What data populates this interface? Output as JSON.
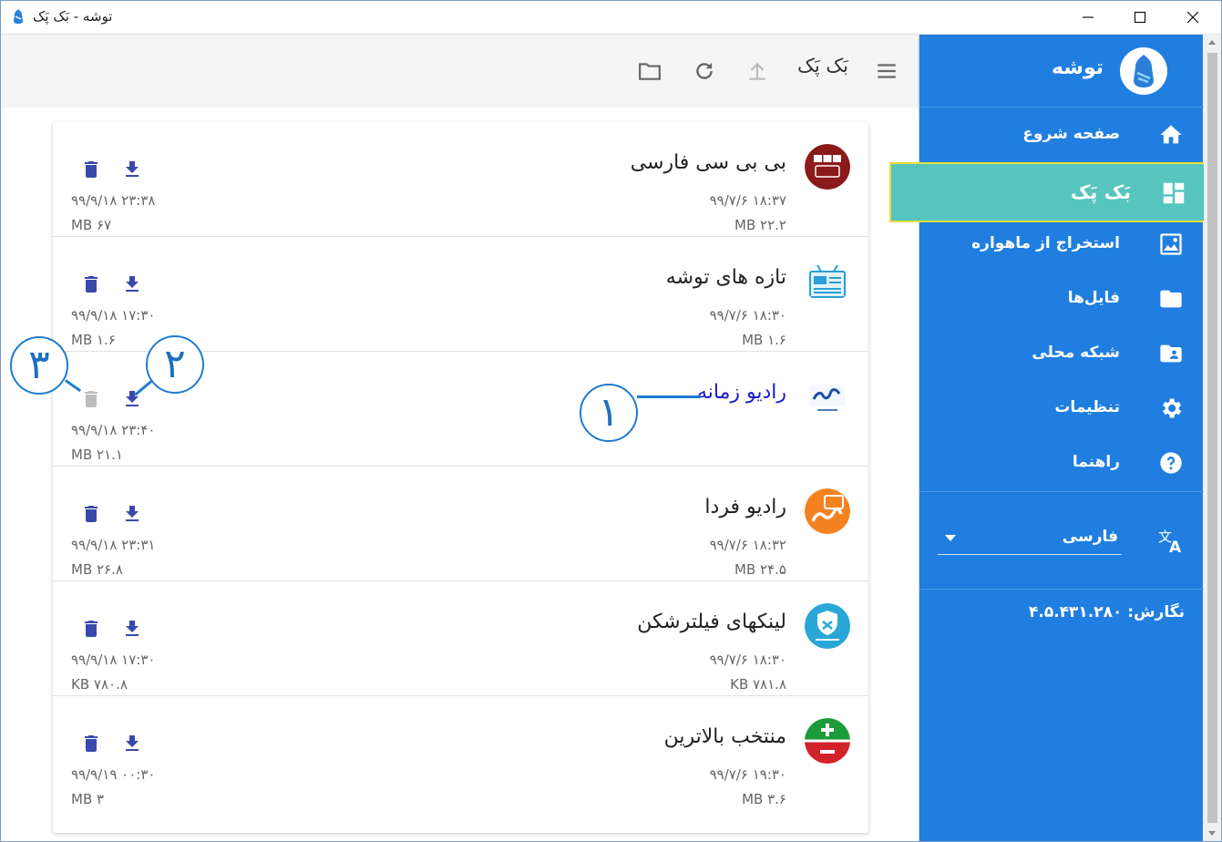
{
  "window": {
    "title": "توشه - بَک پَک",
    "controls": [
      "minimize",
      "maximize",
      "close"
    ]
  },
  "toolbar": {
    "title": "بَک پَک",
    "icons": [
      "menu-icon",
      "upload-icon",
      "refresh-icon",
      "folder-icon"
    ]
  },
  "items": [
    {
      "name": "بی بی سی فارسی",
      "logo": "bbc-persian-logo",
      "received": "۹۹/۷/۶ ۱۸:۳۷",
      "received_size": "MB ۲۲.۲",
      "updated": "۹۹/۹/۱۸ ۲۳:۳۸",
      "updated_size": "MB ۶۷",
      "highlight": false,
      "delete_enabled": true
    },
    {
      "name": "تازه های توشه",
      "logo": "toosheh-news-logo",
      "received": "۹۹/۷/۶ ۱۸:۳۰",
      "received_size": "MB ۱.۶",
      "updated": "۹۹/۹/۱۸ ۱۷:۳۰",
      "updated_size": "MB ۱.۶",
      "highlight": false,
      "delete_enabled": true
    },
    {
      "name": "رادیو زمانه",
      "logo": "radio-zamaneh-logo",
      "received": "",
      "received_size": "",
      "updated": "۹۹/۹/۱۸ ۲۳:۴۰",
      "updated_size": "MB ۲۱.۱",
      "highlight": true,
      "delete_enabled": false
    },
    {
      "name": "رادیو فردا",
      "logo": "radio-farda-logo",
      "received": "۹۹/۷/۶ ۱۸:۳۲",
      "received_size": "MB ۲۴.۵",
      "updated": "۹۹/۹/۱۸ ۲۳:۳۱",
      "updated_size": "MB ۲۶.۸",
      "highlight": false,
      "delete_enabled": true
    },
    {
      "name": "لینکهای فیلترشکن",
      "logo": "filter-breaker-links-logo",
      "received": "۹۹/۷/۶ ۱۸:۳۰",
      "received_size": "KB ۷۸۱.۸",
      "updated": "۹۹/۹/۱۸ ۱۷:۳۰",
      "updated_size": "KB ۷۸۰.۸",
      "highlight": false,
      "delete_enabled": true
    },
    {
      "name": "منتخب بالاترین",
      "logo": "balatarin-logo",
      "received": "۹۹/۷/۶ ۱۹:۳۰",
      "received_size": "MB ۳.۶",
      "updated": "۹۹/۹/۱۹ ۰۰:۳۰",
      "updated_size": "MB ۳",
      "highlight": false,
      "delete_enabled": true
    }
  ],
  "callouts": [
    "۱",
    "۲",
    "۳"
  ],
  "sidebar": {
    "app_name": "توشه",
    "nav": [
      {
        "label": "صفحه شروع",
        "icon": "home-icon",
        "active": false
      },
      {
        "label": "بَک پَک",
        "icon": "dashboard-icon",
        "active": true
      },
      {
        "label": "استخراج از ماهواره",
        "icon": "satellite-image-icon",
        "active": false
      },
      {
        "label": "فایل‌ها",
        "icon": "folder-icon",
        "active": false
      },
      {
        "label": "شبکه محلی",
        "icon": "shared-folder-icon",
        "active": false
      },
      {
        "label": "تنظیمات",
        "icon": "gear-icon",
        "active": false
      },
      {
        "label": "راهنما",
        "icon": "help-icon",
        "active": false
      }
    ],
    "language": {
      "selected": "فارسی",
      "icon": "translate-icon"
    },
    "version": "نگارش: ۴.۵.۴۳۱.۲۸۰"
  },
  "colors": {
    "sidebar_bg": "#1f7ee0",
    "active_item_bg": "#55c5be",
    "active_item_border": "#e6df3c",
    "action_icon": "#3949ab",
    "callout": "#1e7bd0",
    "highlight_text": "#1b1bd0"
  }
}
